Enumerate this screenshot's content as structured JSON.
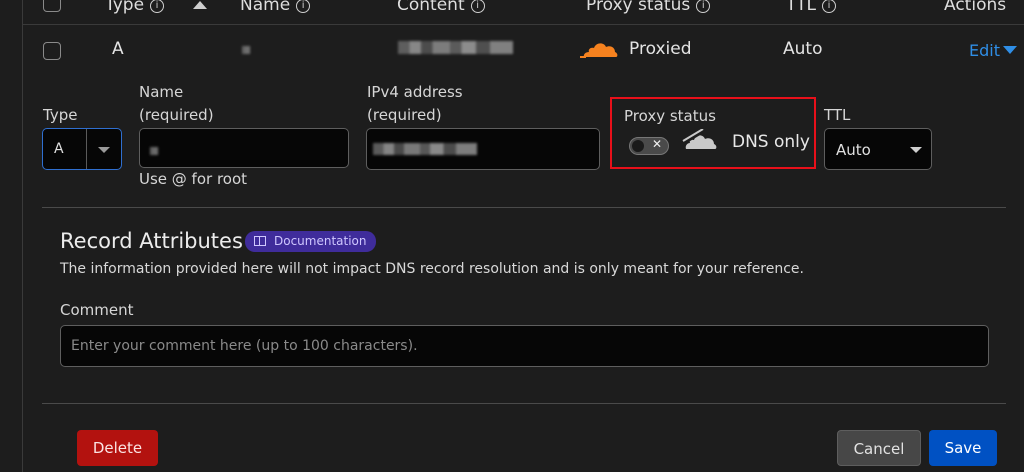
{
  "header": {
    "type": "Type",
    "name": "Name",
    "content": "Content",
    "proxy_status": "Proxy status",
    "ttl": "TTL",
    "actions": "Actions"
  },
  "record": {
    "type": "A",
    "proxy_status": "Proxied",
    "ttl": "Auto",
    "edit": "Edit"
  },
  "form": {
    "type_label": "Type",
    "type_value": "A",
    "name_label_line1": "Name",
    "name_label_line2": "(required)",
    "name_hint": "Use @ for root",
    "ipv4_label_line1": "IPv4 address",
    "ipv4_label_line2": "(required)",
    "proxy_label": "Proxy status",
    "proxy_toggle": "off",
    "proxy_value": "DNS only",
    "ttl_label": "TTL",
    "ttl_value": "Auto"
  },
  "attributes": {
    "title": "Record Attributes",
    "doc_badge": "Documentation",
    "description": "The information provided here will not impact DNS record resolution and is only meant for your reference.",
    "comment_label": "Comment",
    "comment_placeholder": "Enter your comment here (up to 100 characters)."
  },
  "actions": {
    "delete": "Delete",
    "cancel": "Cancel",
    "save": "Save"
  },
  "colors": {
    "proxied_cloud": "#f6821f",
    "link": "#2f8ee6",
    "highlight": "#e8101a",
    "delete": "#b3120f",
    "save": "#0051c3",
    "cancel": "#474747",
    "badge": "#3f2c9b"
  }
}
